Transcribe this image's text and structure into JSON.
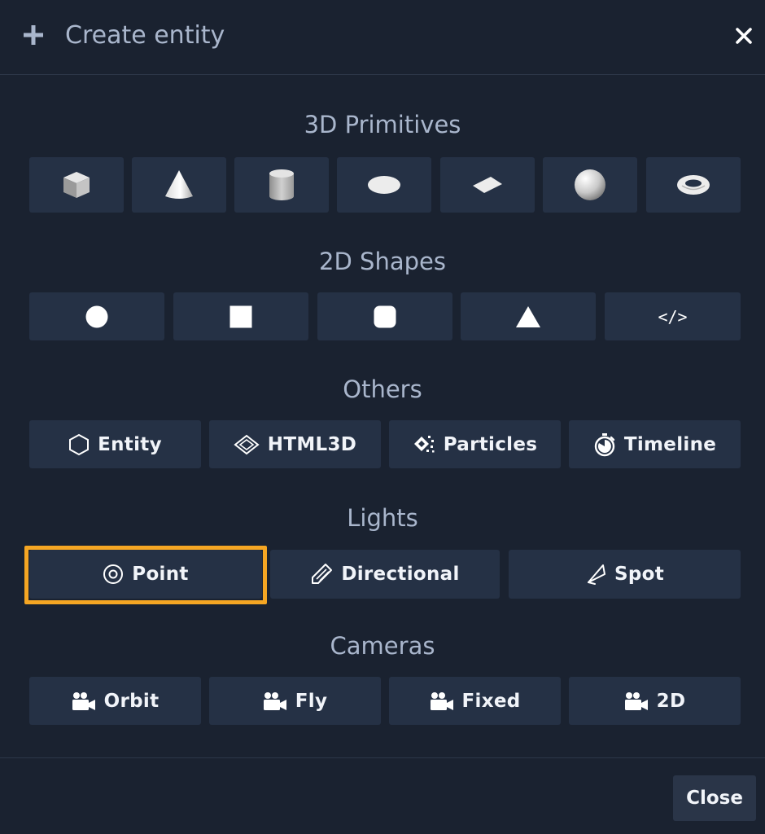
{
  "header": {
    "title": "Create entity",
    "add_icon": "plus-icon",
    "close_icon": "close-icon"
  },
  "sections": {
    "primitives": {
      "title": "3D Primitives",
      "items": [
        {
          "name": "box",
          "icon": "cube-icon"
        },
        {
          "name": "cone",
          "icon": "cone-icon"
        },
        {
          "name": "cylinder",
          "icon": "cylinder-icon"
        },
        {
          "name": "circle",
          "icon": "disc-icon"
        },
        {
          "name": "plane",
          "icon": "plane-icon"
        },
        {
          "name": "sphere",
          "icon": "sphere-icon"
        },
        {
          "name": "torus",
          "icon": "torus-icon"
        }
      ]
    },
    "shapes": {
      "title": "2D Shapes",
      "items": [
        {
          "name": "circle",
          "icon": "circle-icon"
        },
        {
          "name": "rectangle",
          "icon": "square-icon"
        },
        {
          "name": "rounded-rectangle",
          "icon": "rounded-square-icon"
        },
        {
          "name": "triangle",
          "icon": "triangle-icon"
        },
        {
          "name": "html",
          "icon": "code-icon",
          "glyph": "</>"
        }
      ]
    },
    "others": {
      "title": "Others",
      "items": [
        {
          "label": "Entity",
          "icon": "hexagon-icon"
        },
        {
          "label": "HTML3D",
          "icon": "html3d-icon"
        },
        {
          "label": "Particles",
          "icon": "particles-icon"
        },
        {
          "label": "Timeline",
          "icon": "stopwatch-icon"
        }
      ]
    },
    "lights": {
      "title": "Lights",
      "items": [
        {
          "label": "Point",
          "icon": "point-light-icon",
          "highlighted": true
        },
        {
          "label": "Directional",
          "icon": "directional-light-icon"
        },
        {
          "label": "Spot",
          "icon": "spot-light-icon"
        }
      ]
    },
    "cameras": {
      "title": "Cameras",
      "items": [
        {
          "label": "Orbit",
          "icon": "camera-icon"
        },
        {
          "label": "Fly",
          "icon": "camera-icon"
        },
        {
          "label": "Fixed",
          "icon": "camera-icon"
        },
        {
          "label": "2D",
          "icon": "camera-icon"
        }
      ]
    }
  },
  "footer": {
    "close_label": "Close"
  },
  "colors": {
    "background": "#1a2230",
    "tile": "#253145",
    "title_text": "#a9b6cc",
    "highlight": "#f5a623"
  }
}
